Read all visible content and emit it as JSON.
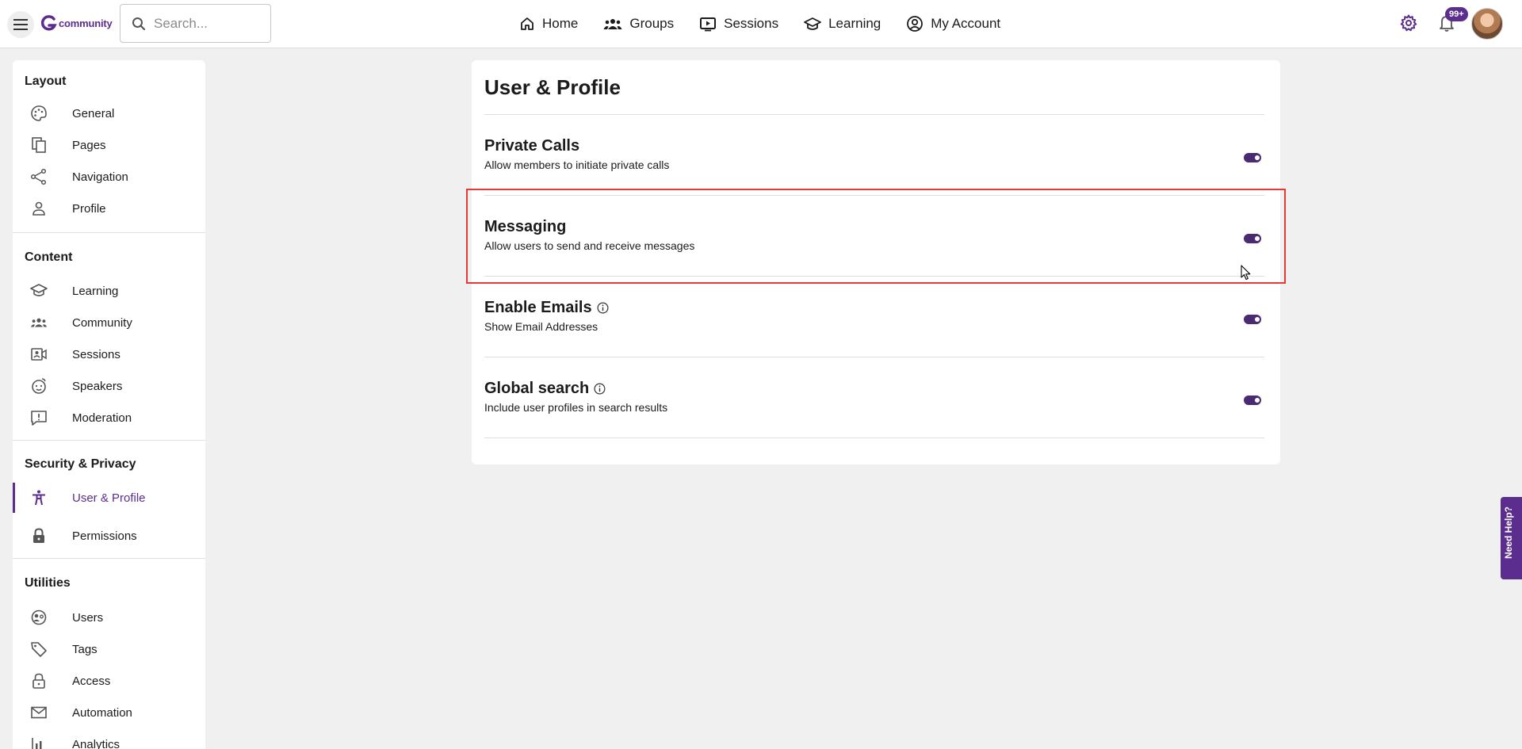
{
  "header": {
    "logo_text": "community",
    "search_placeholder": "Search...",
    "nav": [
      {
        "label": "Home",
        "icon": "home-icon"
      },
      {
        "label": "Groups",
        "icon": "groups-icon"
      },
      {
        "label": "Sessions",
        "icon": "sessions-icon"
      },
      {
        "label": "Learning",
        "icon": "learning-icon"
      },
      {
        "label": "My Account",
        "icon": "account-icon"
      }
    ],
    "notification_badge": "99+"
  },
  "sidebar": {
    "sections": [
      {
        "title": "Layout",
        "items": [
          "General",
          "Pages",
          "Navigation",
          "Profile"
        ]
      },
      {
        "title": "Content",
        "items": [
          "Learning",
          "Community",
          "Sessions",
          "Speakers",
          "Moderation"
        ]
      },
      {
        "title": "Security & Privacy",
        "items": [
          "User & Profile",
          "Permissions"
        ]
      },
      {
        "title": "Utilities",
        "items": [
          "Users",
          "Tags",
          "Access",
          "Automation",
          "Analytics"
        ]
      }
    ],
    "active_item": "User & Profile"
  },
  "main": {
    "title": "User & Profile",
    "settings": [
      {
        "title": "Private Calls",
        "description": "Allow members to initiate private calls",
        "enabled": true,
        "info": false
      },
      {
        "title": "Messaging",
        "description": "Allow users to send and receive messages",
        "enabled": true,
        "info": false
      },
      {
        "title": "Enable Emails",
        "description": "Show Email Addresses",
        "enabled": true,
        "info": true
      },
      {
        "title": "Global search",
        "description": "Include user profiles in search results",
        "enabled": true,
        "info": true
      }
    ]
  },
  "help_tab": {
    "label": "Need Help?"
  },
  "colors": {
    "accent": "#5b2d8e",
    "toggle": "#4a2a73",
    "highlight": "#e53935"
  }
}
